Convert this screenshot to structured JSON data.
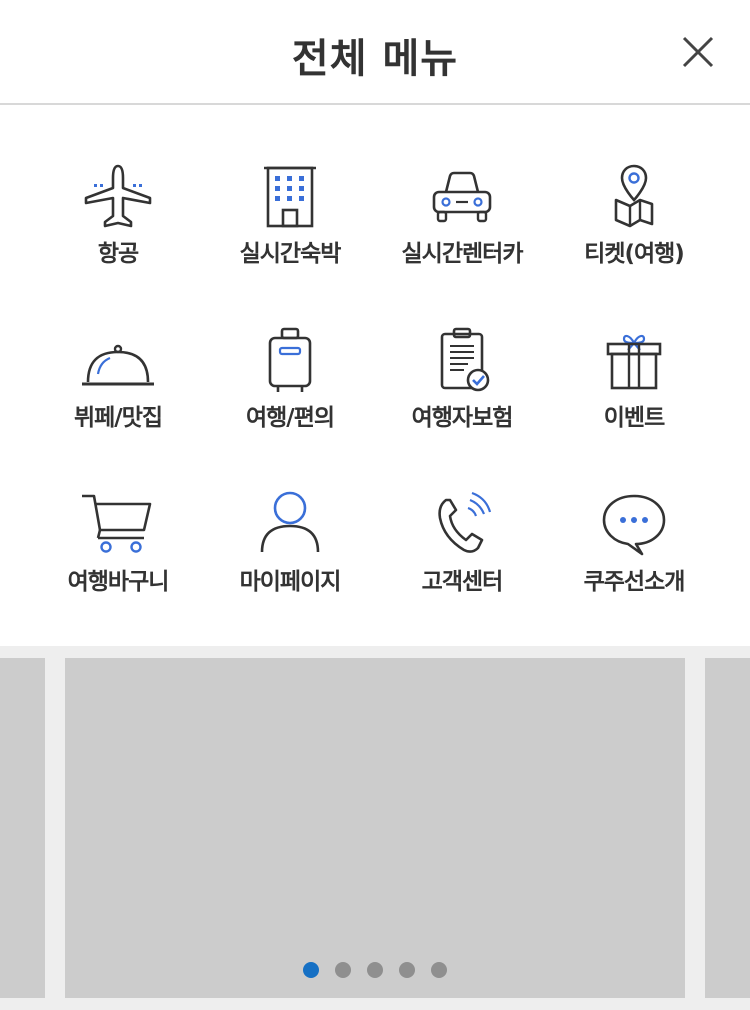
{
  "header": {
    "title": "전체 메뉴",
    "close_icon": "close-icon"
  },
  "menu": {
    "items": [
      {
        "label": "항공",
        "icon": "airplane-icon"
      },
      {
        "label": "실시간숙박",
        "icon": "hotel-building-icon"
      },
      {
        "label": "실시간렌터카",
        "icon": "car-icon"
      },
      {
        "label": "티켓(여행)",
        "icon": "map-pin-icon"
      },
      {
        "label": "뷔페/맛집",
        "icon": "cloche-icon"
      },
      {
        "label": "여행/편의",
        "icon": "suitcase-icon"
      },
      {
        "label": "여행자보험",
        "icon": "clipboard-check-icon"
      },
      {
        "label": "이벤트",
        "icon": "gift-icon"
      },
      {
        "label": "여행바구니",
        "icon": "cart-icon"
      },
      {
        "label": "마이페이지",
        "icon": "person-icon"
      },
      {
        "label": "고객센터",
        "icon": "phone-icon"
      },
      {
        "label": "쿠주선소개",
        "icon": "chat-bubble-icon"
      }
    ]
  },
  "banner": {
    "slide_count": 5,
    "active_index": 0
  },
  "colors": {
    "accent_blue": "#3a6fd8",
    "icon_stroke": "#333333",
    "dot_active": "#1670c4",
    "dot_inactive": "#8f8f8f",
    "slide_bg": "#cccccc",
    "banner_bg": "#eeeeee"
  }
}
